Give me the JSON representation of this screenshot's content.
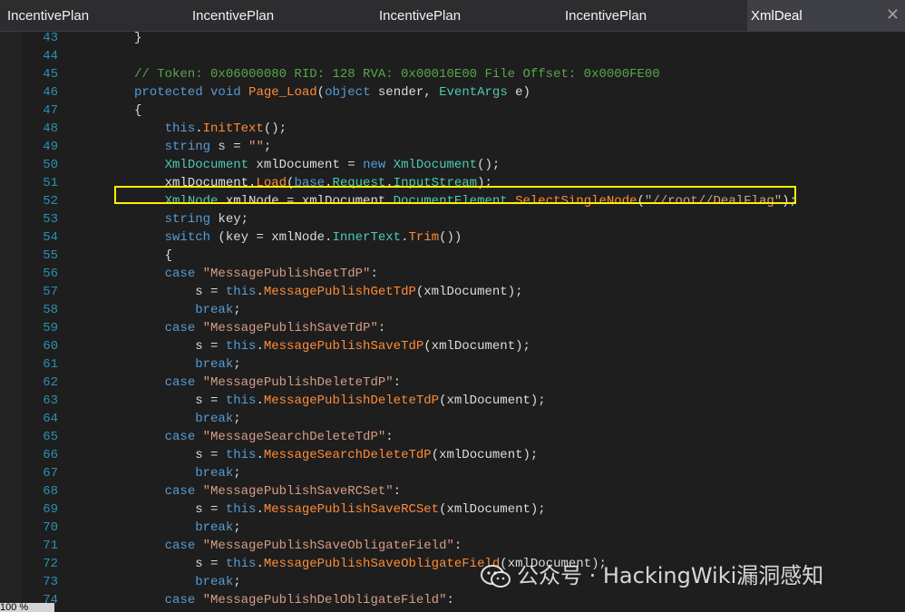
{
  "tabs": [
    {
      "label": "IncentivePlan"
    },
    {
      "label": "IncentivePlan"
    },
    {
      "label": "IncentivePlan"
    },
    {
      "label": "IncentivePlan"
    },
    {
      "label": "XmlDeal",
      "active": true,
      "close": "✕"
    }
  ],
  "colors": {
    "keyword": "#569cd6",
    "comment": "#57a64a",
    "type": "#4ec9b0",
    "method": "#ff8c38",
    "string": "#d69d85",
    "line_number": "#2b91af",
    "highlight_border": "#ffef00"
  },
  "highlighted_line": 52,
  "lines": [
    {
      "n": "43",
      "tokens": [
        [
          "p",
          "}"
        ]
      ]
    },
    {
      "n": "44",
      "tokens": []
    },
    {
      "n": "45",
      "tokens": [
        [
          "cm",
          "// Token: 0x06000080 RID: 128 RVA: 0x00010E00 File Offset: 0x0000FE00"
        ]
      ]
    },
    {
      "n": "46",
      "tokens": [
        [
          "kw",
          "protected"
        ],
        [
          "p",
          " "
        ],
        [
          "kw",
          "void"
        ],
        [
          "p",
          " "
        ],
        [
          "mt",
          "Page_Load"
        ],
        [
          "p",
          "("
        ],
        [
          "kw",
          "object"
        ],
        [
          "p",
          " sender, "
        ],
        [
          "ty",
          "EventArgs"
        ],
        [
          "p",
          " e)"
        ]
      ]
    },
    {
      "n": "47",
      "tokens": [
        [
          "p",
          "{"
        ]
      ]
    },
    {
      "n": "48",
      "tokens": [
        [
          "p",
          "    "
        ],
        [
          "kw",
          "this"
        ],
        [
          "p",
          "."
        ],
        [
          "mt",
          "InitText"
        ],
        [
          "p",
          "();"
        ]
      ]
    },
    {
      "n": "49",
      "tokens": [
        [
          "p",
          "    "
        ],
        [
          "kw",
          "string"
        ],
        [
          "p",
          " s = "
        ],
        [
          "st",
          "\"\""
        ],
        [
          "p",
          ";"
        ]
      ]
    },
    {
      "n": "50",
      "tokens": [
        [
          "p",
          "    "
        ],
        [
          "ty",
          "XmlDocument"
        ],
        [
          "p",
          " xmlDocument = "
        ],
        [
          "kw",
          "new"
        ],
        [
          "p",
          " "
        ],
        [
          "ty",
          "XmlDocument"
        ],
        [
          "p",
          "();"
        ]
      ]
    },
    {
      "n": "51",
      "tokens": [
        [
          "p",
          "    xmlDocument."
        ],
        [
          "mt",
          "Load"
        ],
        [
          "p",
          "("
        ],
        [
          "kw",
          "base"
        ],
        [
          "p",
          "."
        ],
        [
          "pr",
          "Request"
        ],
        [
          "p",
          "."
        ],
        [
          "pr",
          "InputStream"
        ],
        [
          "p",
          ");"
        ]
      ]
    },
    {
      "n": "52",
      "tokens": [
        [
          "p",
          "    "
        ],
        [
          "ty",
          "XmlNode"
        ],
        [
          "p",
          " xmlNode = xmlDocument."
        ],
        [
          "pr",
          "DocumentElement"
        ],
        [
          "p",
          "."
        ],
        [
          "mt",
          "SelectSingleNode"
        ],
        [
          "p",
          "("
        ],
        [
          "st",
          "\"//root//DealFlag\""
        ],
        [
          "p",
          ");"
        ]
      ]
    },
    {
      "n": "53",
      "tokens": [
        [
          "p",
          "    "
        ],
        [
          "kw",
          "string"
        ],
        [
          "p",
          " key;"
        ]
      ]
    },
    {
      "n": "54",
      "tokens": [
        [
          "p",
          "    "
        ],
        [
          "kw",
          "switch"
        ],
        [
          "p",
          " (key = xmlNode."
        ],
        [
          "pr",
          "InnerText"
        ],
        [
          "p",
          "."
        ],
        [
          "mt",
          "Trim"
        ],
        [
          "p",
          "())"
        ]
      ]
    },
    {
      "n": "55",
      "tokens": [
        [
          "p",
          "    {"
        ]
      ]
    },
    {
      "n": "56",
      "tokens": [
        [
          "p",
          "    "
        ],
        [
          "kw",
          "case"
        ],
        [
          "p",
          " "
        ],
        [
          "st",
          "\"MessagePublishGetTdP\""
        ],
        [
          "p",
          ":"
        ]
      ]
    },
    {
      "n": "57",
      "tokens": [
        [
          "p",
          "        s = "
        ],
        [
          "kw",
          "this"
        ],
        [
          "p",
          "."
        ],
        [
          "mt",
          "MessagePublishGetTdP"
        ],
        [
          "p",
          "(xmlDocument);"
        ]
      ]
    },
    {
      "n": "58",
      "tokens": [
        [
          "p",
          "        "
        ],
        [
          "kw",
          "break"
        ],
        [
          "p",
          ";"
        ]
      ]
    },
    {
      "n": "59",
      "tokens": [
        [
          "p",
          "    "
        ],
        [
          "kw",
          "case"
        ],
        [
          "p",
          " "
        ],
        [
          "st",
          "\"MessagePublishSaveTdP\""
        ],
        [
          "p",
          ":"
        ]
      ]
    },
    {
      "n": "60",
      "tokens": [
        [
          "p",
          "        s = "
        ],
        [
          "kw",
          "this"
        ],
        [
          "p",
          "."
        ],
        [
          "mt",
          "MessagePublishSaveTdP"
        ],
        [
          "p",
          "(xmlDocument);"
        ]
      ]
    },
    {
      "n": "61",
      "tokens": [
        [
          "p",
          "        "
        ],
        [
          "kw",
          "break"
        ],
        [
          "p",
          ";"
        ]
      ]
    },
    {
      "n": "62",
      "tokens": [
        [
          "p",
          "    "
        ],
        [
          "kw",
          "case"
        ],
        [
          "p",
          " "
        ],
        [
          "st",
          "\"MessagePublishDeleteTdP\""
        ],
        [
          "p",
          ":"
        ]
      ]
    },
    {
      "n": "63",
      "tokens": [
        [
          "p",
          "        s = "
        ],
        [
          "kw",
          "this"
        ],
        [
          "p",
          "."
        ],
        [
          "mt",
          "MessagePublishDeleteTdP"
        ],
        [
          "p",
          "(xmlDocument);"
        ]
      ]
    },
    {
      "n": "64",
      "tokens": [
        [
          "p",
          "        "
        ],
        [
          "kw",
          "break"
        ],
        [
          "p",
          ";"
        ]
      ]
    },
    {
      "n": "65",
      "tokens": [
        [
          "p",
          "    "
        ],
        [
          "kw",
          "case"
        ],
        [
          "p",
          " "
        ],
        [
          "st",
          "\"MessageSearchDeleteTdP\""
        ],
        [
          "p",
          ":"
        ]
      ]
    },
    {
      "n": "66",
      "tokens": [
        [
          "p",
          "        s = "
        ],
        [
          "kw",
          "this"
        ],
        [
          "p",
          "."
        ],
        [
          "mt",
          "MessageSearchDeleteTdP"
        ],
        [
          "p",
          "(xmlDocument);"
        ]
      ]
    },
    {
      "n": "67",
      "tokens": [
        [
          "p",
          "        "
        ],
        [
          "kw",
          "break"
        ],
        [
          "p",
          ";"
        ]
      ]
    },
    {
      "n": "68",
      "tokens": [
        [
          "p",
          "    "
        ],
        [
          "kw",
          "case"
        ],
        [
          "p",
          " "
        ],
        [
          "st",
          "\"MessagePublishSaveRCSet\""
        ],
        [
          "p",
          ":"
        ]
      ]
    },
    {
      "n": "69",
      "tokens": [
        [
          "p",
          "        s = "
        ],
        [
          "kw",
          "this"
        ],
        [
          "p",
          "."
        ],
        [
          "mt",
          "MessagePublishSaveRCSet"
        ],
        [
          "p",
          "(xmlDocument);"
        ]
      ]
    },
    {
      "n": "70",
      "tokens": [
        [
          "p",
          "        "
        ],
        [
          "kw",
          "break"
        ],
        [
          "p",
          ";"
        ]
      ]
    },
    {
      "n": "71",
      "tokens": [
        [
          "p",
          "    "
        ],
        [
          "kw",
          "case"
        ],
        [
          "p",
          " "
        ],
        [
          "st",
          "\"MessagePublishSaveObligateField\""
        ],
        [
          "p",
          ":"
        ]
      ]
    },
    {
      "n": "72",
      "tokens": [
        [
          "p",
          "        s = "
        ],
        [
          "kw",
          "this"
        ],
        [
          "p",
          "."
        ],
        [
          "mt",
          "MessagePublishSaveObligateField"
        ],
        [
          "p",
          "(xmlDocument);"
        ]
      ]
    },
    {
      "n": "73",
      "tokens": [
        [
          "p",
          "        "
        ],
        [
          "kw",
          "break"
        ],
        [
          "p",
          ";"
        ]
      ]
    },
    {
      "n": "74",
      "tokens": [
        [
          "p",
          "    "
        ],
        [
          "kw",
          "case"
        ],
        [
          "p",
          " "
        ],
        [
          "st",
          "\"MessagePublishDelObligateField\""
        ],
        [
          "p",
          ":"
        ]
      ]
    }
  ],
  "status": {
    "zoom": "100 %"
  },
  "watermark": {
    "text": "公众号 · HackingWiki漏洞感知",
    "icon": "wechat-icon"
  }
}
